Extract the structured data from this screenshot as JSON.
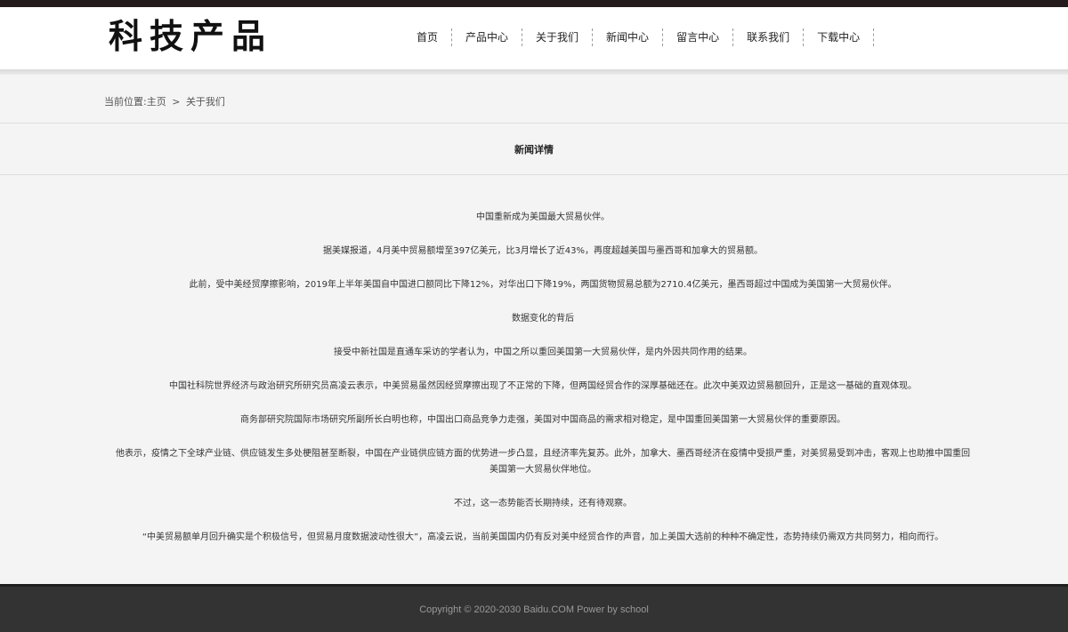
{
  "header": {
    "logo": "科技产品",
    "nav": [
      "首页",
      "产品中心",
      "关于我们",
      "新闻中心",
      "留言中心",
      "联系我们",
      "下载中心"
    ]
  },
  "breadcrumb": {
    "prefix": "当前位置:",
    "home": "主页",
    "separator": ">",
    "current": "关于我们"
  },
  "section": {
    "title": "新闻详情"
  },
  "article": {
    "paragraphs": [
      "中国重新成为美国最大贸易伙伴。",
      "据美媒报道，4月美中贸易额增至397亿美元，比3月增长了近43%，再度超越美国与墨西哥和加拿大的贸易额。",
      "此前，受中美经贸摩擦影响，2019年上半年美国自中国进口额同比下降12%，对华出口下降19%，两国货物贸易总额为2710.4亿美元，墨西哥超过中国成为美国第一大贸易伙伴。",
      "数据变化的背后",
      "接受中新社国是直通车采访的学者认为，中国之所以重回美国第一大贸易伙伴，是内外因共同作用的结果。",
      "中国社科院世界经济与政治研究所研究员高凌云表示，中美贸易虽然因经贸摩擦出现了不正常的下降，但两国经贸合作的深厚基础还在。此次中美双边贸易额回升，正是这一基础的直观体现。",
      "商务部研究院国际市场研究所副所长白明也称，中国出口商品竞争力走强，美国对中国商品的需求相对稳定，是中国重回美国第一大贸易伙伴的重要原因。",
      "他表示，疫情之下全球产业链、供应链发生多处梗阻甚至断裂，中国在产业链供应链方面的优势进一步凸显，且经济率先复苏。此外，加拿大、墨西哥经济在疫情中受损严重，对美贸易受到冲击，客观上也助推中国重回美国第一大贸易伙伴地位。",
      "不过，这一态势能否长期持续，还有待观察。",
      "“中美贸易额单月回升确实是个积极信号，但贸易月度数据波动性很大”，高凌云说，当前美国国内仍有反对美中经贸合作的声音，加上美国大选前的种种不确定性，态势持续仍需双方共同努力，相向而行。"
    ]
  },
  "footer": {
    "copyright": "Copyright © 2020-2030 Baidu.COM Power by school"
  }
}
